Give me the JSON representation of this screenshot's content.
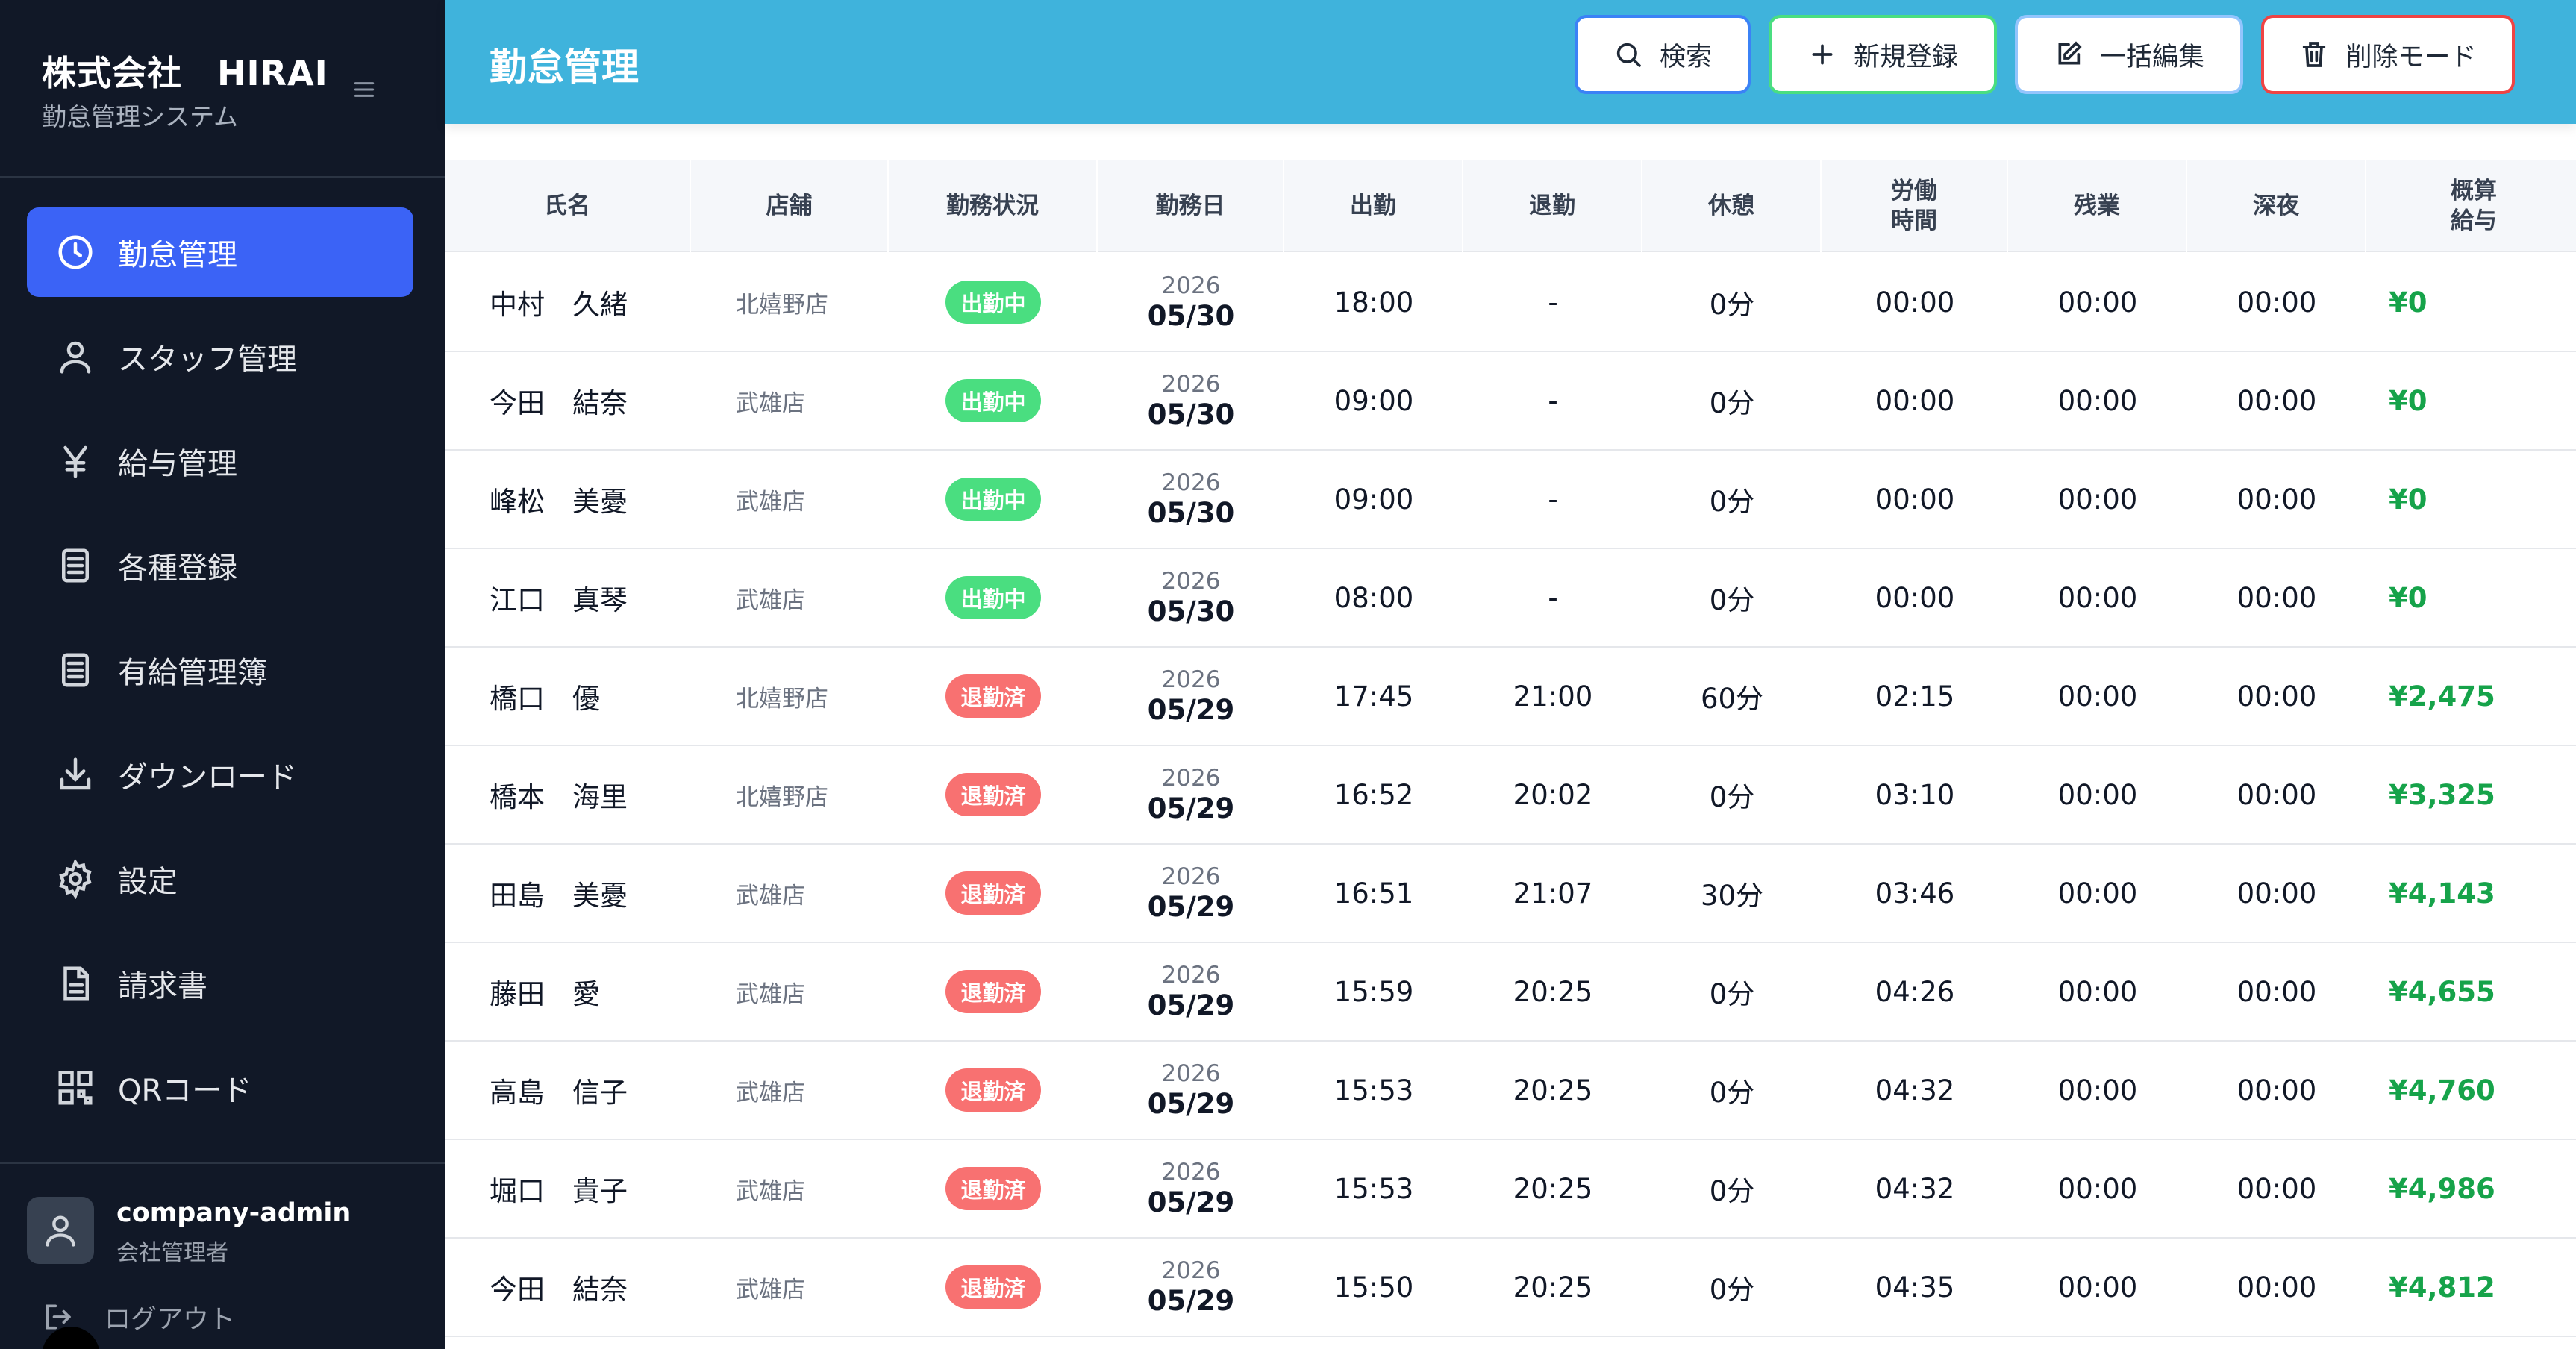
{
  "sidebar": {
    "brand_title": "株式会社　HIRAI",
    "brand_subtitle": "勤怠管理システム",
    "items": [
      {
        "label": "勤怠管理",
        "icon": "clock-icon",
        "active": true
      },
      {
        "label": "スタッフ管理",
        "icon": "user-icon"
      },
      {
        "label": "給与管理",
        "icon": "yen-icon"
      },
      {
        "label": "各種登録",
        "icon": "list-icon"
      },
      {
        "label": "有給管理簿",
        "icon": "list-icon"
      },
      {
        "label": "ダウンロード",
        "icon": "download-icon"
      },
      {
        "label": "設定",
        "icon": "gear-icon"
      },
      {
        "label": "請求書",
        "icon": "document-icon"
      },
      {
        "label": "QRコード",
        "icon": "qr-icon"
      }
    ],
    "user": {
      "name": "company-admin",
      "role": "会社管理者"
    },
    "logout_label": "ログアウト"
  },
  "header": {
    "title": "勤怠管理",
    "buttons": {
      "search": "検索",
      "create": "新規登録",
      "bulk_edit": "一括編集",
      "delete_mode": "削除モード"
    }
  },
  "table": {
    "columns": [
      "氏名",
      "店舗",
      "勤務状況",
      "勤務日",
      "出勤",
      "退勤",
      "休憩",
      "労働\n時間",
      "残業",
      "深夜",
      "概算\n給与"
    ],
    "rows": [
      {
        "name": "中村　久緒",
        "store": "北嬉野店",
        "status": "出勤中",
        "status_type": "on",
        "year": "2026",
        "date": "05/30",
        "in": "18:00",
        "out": "-",
        "break": "0分",
        "work": "00:00",
        "overtime": "00:00",
        "night": "00:00",
        "pay": "¥0"
      },
      {
        "name": "今田　結奈",
        "store": "武雄店",
        "status": "出勤中",
        "status_type": "on",
        "year": "2026",
        "date": "05/30",
        "in": "09:00",
        "out": "-",
        "break": "0分",
        "work": "00:00",
        "overtime": "00:00",
        "night": "00:00",
        "pay": "¥0"
      },
      {
        "name": "峰松　美憂",
        "store": "武雄店",
        "status": "出勤中",
        "status_type": "on",
        "year": "2026",
        "date": "05/30",
        "in": "09:00",
        "out": "-",
        "break": "0分",
        "work": "00:00",
        "overtime": "00:00",
        "night": "00:00",
        "pay": "¥0"
      },
      {
        "name": "江口　真琴",
        "store": "武雄店",
        "status": "出勤中",
        "status_type": "on",
        "year": "2026",
        "date": "05/30",
        "in": "08:00",
        "out": "-",
        "break": "0分",
        "work": "00:00",
        "overtime": "00:00",
        "night": "00:00",
        "pay": "¥0"
      },
      {
        "name": "橋口　優",
        "store": "北嬉野店",
        "status": "退勤済",
        "status_type": "off",
        "year": "2026",
        "date": "05/29",
        "in": "17:45",
        "out": "21:00",
        "break": "60分",
        "work": "02:15",
        "overtime": "00:00",
        "night": "00:00",
        "pay": "¥2,475"
      },
      {
        "name": "橋本　海里",
        "store": "北嬉野店",
        "status": "退勤済",
        "status_type": "off",
        "year": "2026",
        "date": "05/29",
        "in": "16:52",
        "out": "20:02",
        "break": "0分",
        "work": "03:10",
        "overtime": "00:00",
        "night": "00:00",
        "pay": "¥3,325"
      },
      {
        "name": "田島　美憂",
        "store": "武雄店",
        "status": "退勤済",
        "status_type": "off",
        "year": "2026",
        "date": "05/29",
        "in": "16:51",
        "out": "21:07",
        "break": "30分",
        "work": "03:46",
        "overtime": "00:00",
        "night": "00:00",
        "pay": "¥4,143"
      },
      {
        "name": "藤田　愛",
        "store": "武雄店",
        "status": "退勤済",
        "status_type": "off",
        "year": "2026",
        "date": "05/29",
        "in": "15:59",
        "out": "20:25",
        "break": "0分",
        "work": "04:26",
        "overtime": "00:00",
        "night": "00:00",
        "pay": "¥4,655"
      },
      {
        "name": "高島　信子",
        "store": "武雄店",
        "status": "退勤済",
        "status_type": "off",
        "year": "2026",
        "date": "05/29",
        "in": "15:53",
        "out": "20:25",
        "break": "0分",
        "work": "04:32",
        "overtime": "00:00",
        "night": "00:00",
        "pay": "¥4,760"
      },
      {
        "name": "堀口　貴子",
        "store": "武雄店",
        "status": "退勤済",
        "status_type": "off",
        "year": "2026",
        "date": "05/29",
        "in": "15:53",
        "out": "20:25",
        "break": "0分",
        "work": "04:32",
        "overtime": "00:00",
        "night": "00:00",
        "pay": "¥4,986"
      },
      {
        "name": "今田　結奈",
        "store": "武雄店",
        "status": "退勤済",
        "status_type": "off",
        "year": "2026",
        "date": "05/29",
        "in": "15:50",
        "out": "20:25",
        "break": "0分",
        "work": "04:35",
        "overtime": "00:00",
        "night": "00:00",
        "pay": "¥4,812"
      }
    ]
  },
  "colors": {
    "sidebar_bg": "#111827",
    "active_nav": "#3b63f6",
    "header_bg": "#3fb3dc",
    "badge_on": "#4ade80",
    "badge_off": "#f87171",
    "pay_text": "#16a34a"
  }
}
